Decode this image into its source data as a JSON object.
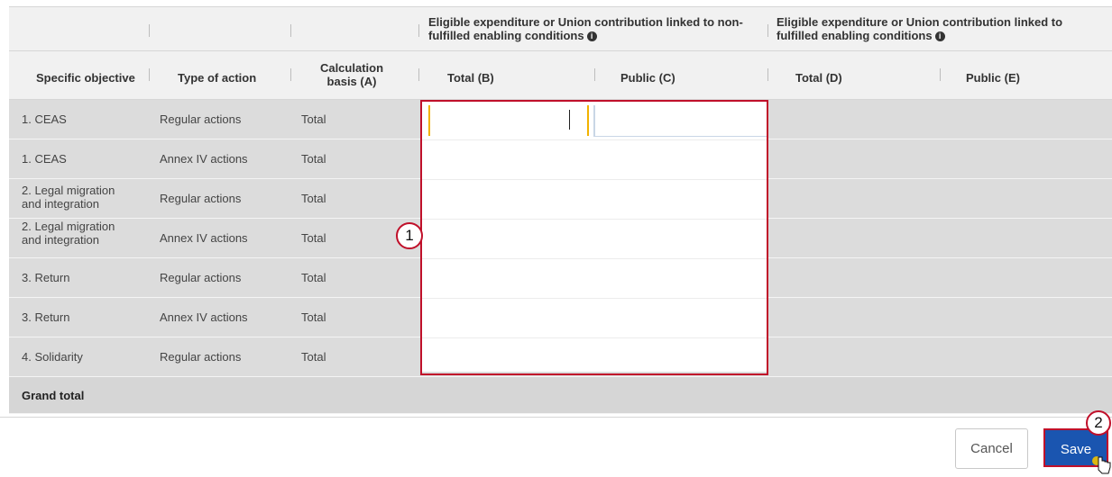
{
  "table": {
    "group_headers": {
      "non_fulfilled_line1": "Eligible expenditure or Union contribution linked to non-",
      "non_fulfilled_line2": "fulfilled enabling conditions",
      "fulfilled_line1": "Eligible expenditure or Union contribution linked to",
      "fulfilled_line2": "fulfilled enabling conditions"
    },
    "columns": {
      "specific_objective": "Specific objective",
      "type_of_action": "Type of action",
      "calc_basis_line1": "Calculation",
      "calc_basis_line2": "basis (A)",
      "total_b": "Total (B)",
      "public_c": "Public (C)",
      "total_d": "Total (D)",
      "public_e": "Public (E)"
    },
    "rows": [
      {
        "objective_l1": "1. CEAS",
        "objective_l2": "",
        "type": "Regular actions",
        "basis": "Total"
      },
      {
        "objective_l1": "1. CEAS",
        "objective_l2": "",
        "type": "Annex IV actions",
        "basis": "Total"
      },
      {
        "objective_l1": "2. Legal migration",
        "objective_l2": "and integration",
        "type": "Regular actions",
        "basis": "Total"
      },
      {
        "objective_l1": "2. Legal migration",
        "objective_l2": "and integration",
        "type": "Annex IV actions",
        "basis": "Total"
      },
      {
        "objective_l1": "3. Return",
        "objective_l2": "",
        "type": "Regular actions",
        "basis": "Total"
      },
      {
        "objective_l1": "3. Return",
        "objective_l2": "",
        "type": "Annex IV actions",
        "basis": "Total"
      },
      {
        "objective_l1": "4. Solidarity",
        "objective_l2": "",
        "type": "Regular actions",
        "basis": "Total"
      }
    ],
    "grand_total_label": "Grand total",
    "info_glyph": "i"
  },
  "callouts": {
    "one": "1",
    "two": "2"
  },
  "buttons": {
    "cancel": "Cancel",
    "save": "Save"
  },
  "colors": {
    "accent_red": "#c0102a",
    "save_blue": "#1a55b0",
    "row_gray": "#dcdcdc",
    "input_focus": "#f2b200"
  }
}
